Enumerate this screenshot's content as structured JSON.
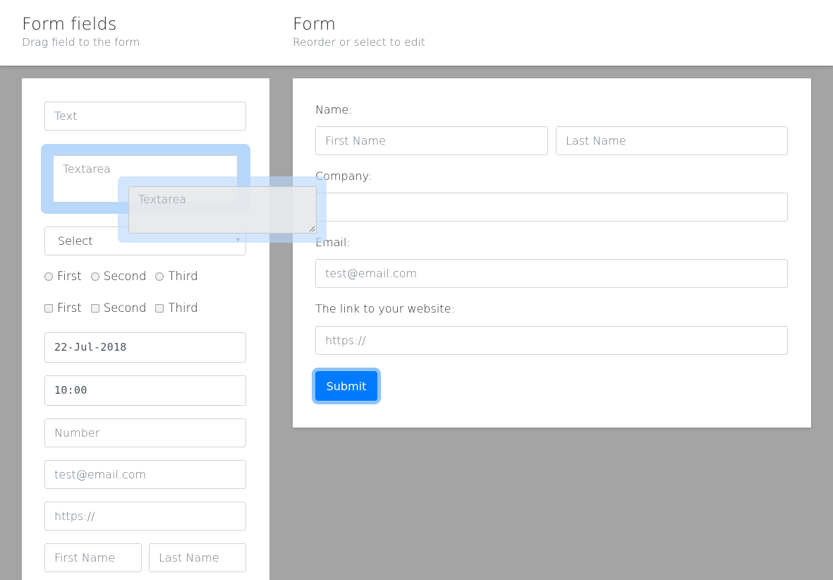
{
  "header": {
    "palette_title": "Form fields",
    "palette_subtitle": "Drag field to the form",
    "form_title": "Form",
    "form_subtitle": "Reorder or select to edit"
  },
  "palette": {
    "text_placeholder": "Text",
    "textarea_placeholder": "Textarea",
    "select_value": "Select",
    "radios": [
      "First",
      "Second",
      "Third"
    ],
    "checkboxes": [
      "First",
      "Second",
      "Third"
    ],
    "date_value": "22-Jul-2018",
    "time_value": "10:00",
    "number_placeholder": "Number",
    "email_placeholder": "test@email.com",
    "url_placeholder": "https://",
    "first_name_placeholder": "First Name",
    "last_name_placeholder": "Last Name"
  },
  "drag_ghost": {
    "placeholder": "Textarea"
  },
  "form": {
    "name_label": "Name:",
    "first_name_placeholder": "First Name",
    "last_name_placeholder": "Last Name",
    "company_label": "Company:",
    "company_value": "",
    "email_label": "Email:",
    "email_placeholder": "test@email.com",
    "website_label": "The link to your website:",
    "website_placeholder": "https://",
    "submit_label": "Submit"
  },
  "colors": {
    "background": "#a4a4a4",
    "accent": "#007bff",
    "selection": "#b7d7fb"
  }
}
